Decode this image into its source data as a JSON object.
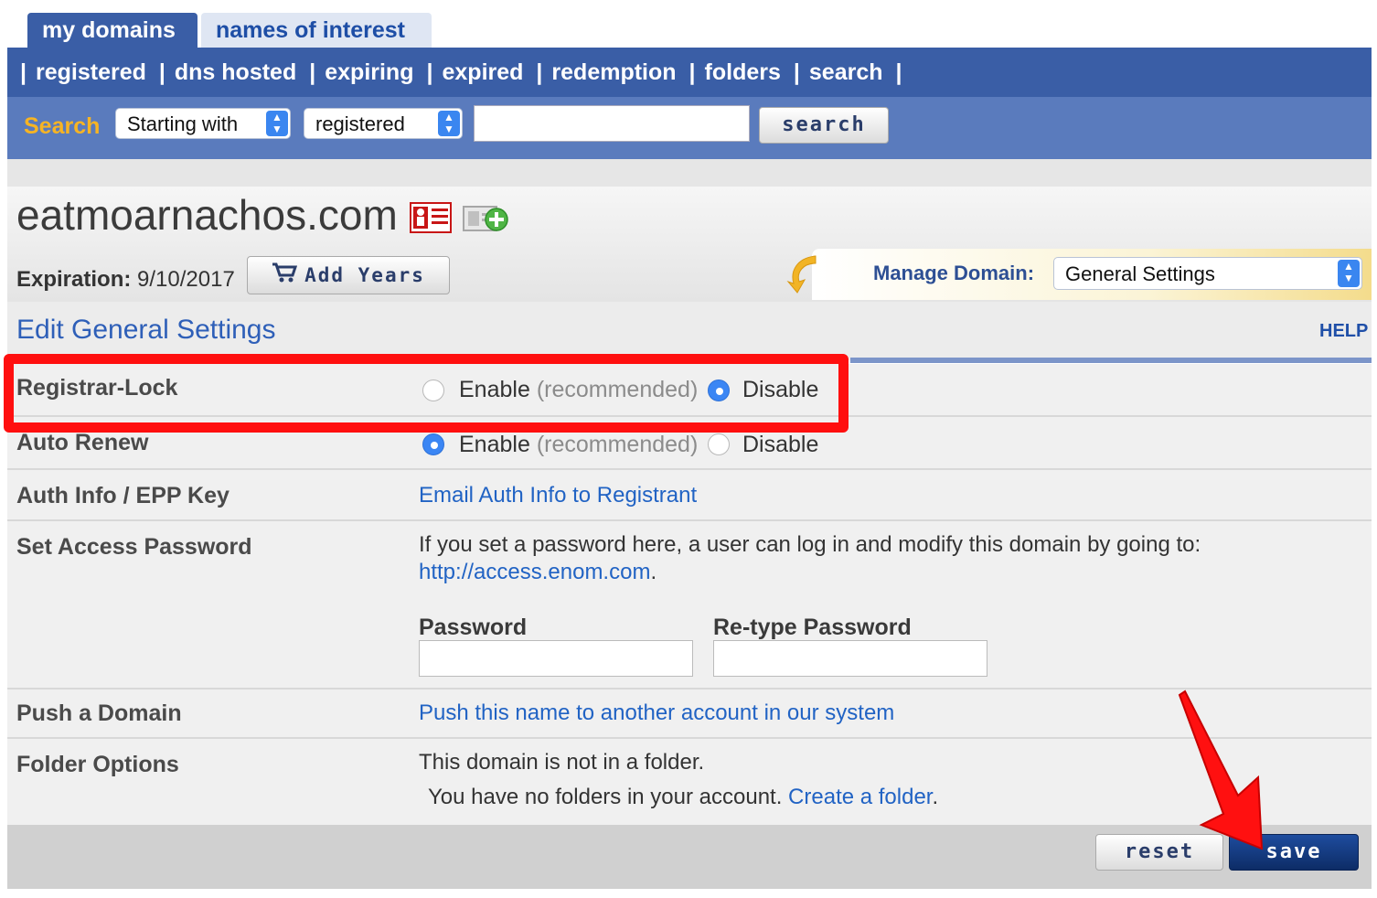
{
  "tabs": [
    {
      "label": "my domains"
    },
    {
      "label": "names of interest"
    }
  ],
  "nav": {
    "separator": "|",
    "items": [
      "registered",
      "dns hosted",
      "expiring",
      "expired",
      "redemption",
      "folders",
      "search"
    ]
  },
  "search": {
    "label": "Search",
    "mode": "Starting with",
    "scope": "registered",
    "query": "",
    "button": "search"
  },
  "domain": {
    "name": "eatmoarnachos.com",
    "expiration_label": "Expiration:",
    "expiration_value": "9/10/2017",
    "add_years": "Add Years"
  },
  "manage": {
    "label": "Manage Domain:",
    "selected": "General Settings"
  },
  "section": {
    "title": "Edit General Settings",
    "help": "HELP"
  },
  "settings": {
    "registrar_lock": {
      "label": "Registrar-Lock",
      "enable": "Enable",
      "recommended": "(recommended)",
      "disable": "Disable",
      "selected": "disable"
    },
    "auto_renew": {
      "label": "Auto Renew",
      "enable": "Enable",
      "recommended": "(recommended)",
      "disable": "Disable",
      "selected": "enable"
    },
    "auth_info": {
      "label": "Auth Info / EPP Key",
      "link": "Email Auth Info to Registrant"
    },
    "access_password": {
      "label": "Set Access Password",
      "description": "If you set a password here, a user can log in and modify this domain by going to:",
      "url": "http://access.enom.com",
      "url_suffix": ".",
      "password_label": "Password",
      "retype_label": "Re-type Password",
      "password_value": "",
      "retype_value": ""
    },
    "push_domain": {
      "label": "Push a Domain",
      "link": "Push this name to another account in our system"
    },
    "folder_options": {
      "label": "Folder Options",
      "status": "This domain is not in a folder.",
      "no_folders": "You have no folders in your account.",
      "create_link": "Create a folder",
      "create_suffix": "."
    }
  },
  "actions": {
    "reset": "reset",
    "save": "save"
  },
  "colors": {
    "nav_bg": "#3a5ea6",
    "search_bar_bg": "#5a7bbd",
    "search_label": "#f7b423",
    "link": "#2163c4",
    "highlight": "#ff0f0f",
    "save_bg": "#123a80"
  }
}
